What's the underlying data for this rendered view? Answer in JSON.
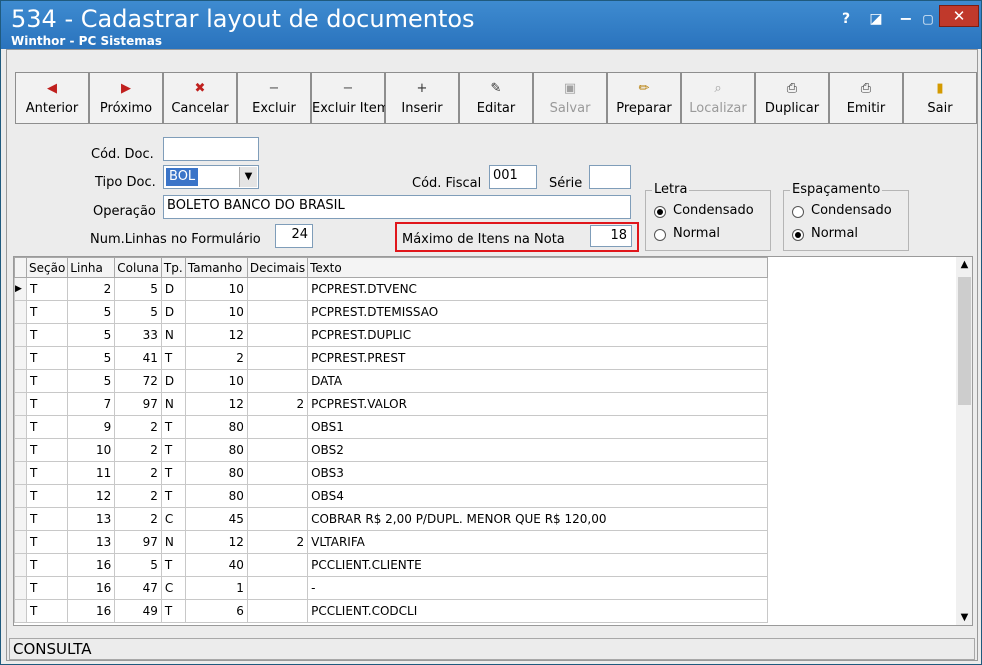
{
  "window": {
    "title": "534 - Cadastrar layout de documentos",
    "subtitle": "Winthor - PC Sistemas",
    "help": "?",
    "close": "✕"
  },
  "toolbar": [
    {
      "label": "Anterior",
      "icon": "arrow-left-icon",
      "glyph": "◀",
      "color": "#c0201e",
      "enabled": true
    },
    {
      "label": "Próximo",
      "icon": "arrow-right-icon",
      "glyph": "▶",
      "color": "#c0201e",
      "enabled": true
    },
    {
      "label": "Cancelar",
      "icon": "cancel-icon",
      "glyph": "✖",
      "color": "#c0201e",
      "enabled": true
    },
    {
      "label": "Excluir",
      "icon": "minus-icon",
      "glyph": "−",
      "color": "#555555",
      "enabled": true
    },
    {
      "label": "Excluir Item",
      "icon": "minus-icon",
      "glyph": "−",
      "color": "#555555",
      "enabled": true
    },
    {
      "label": "Inserir",
      "icon": "plus-icon",
      "glyph": "+",
      "color": "#333333",
      "enabled": true
    },
    {
      "label": "Editar",
      "icon": "edit-icon",
      "glyph": "✎",
      "color": "#333333",
      "enabled": true
    },
    {
      "label": "Salvar",
      "icon": "save-icon",
      "glyph": "▣",
      "color": "#9a9a9a",
      "enabled": false
    },
    {
      "label": "Preparar",
      "icon": "pencil-icon",
      "glyph": "✏",
      "color": "#b57b00",
      "enabled": true
    },
    {
      "label": "Localizar",
      "icon": "search-icon",
      "glyph": "⌕",
      "color": "#9a9a9a",
      "enabled": false
    },
    {
      "label": "Duplicar",
      "icon": "printer-icon",
      "glyph": "⎙",
      "color": "#333333",
      "enabled": true
    },
    {
      "label": "Emitir",
      "icon": "print-icon",
      "glyph": "⎙",
      "color": "#333333",
      "enabled": true
    },
    {
      "label": "Sair",
      "icon": "exit-door-icon",
      "glyph": "▮",
      "color": "#d49a00",
      "enabled": true
    }
  ],
  "form": {
    "cod_doc_label": "Cód. Doc.",
    "cod_doc_value": "",
    "tipo_doc_label": "Tipo Doc.",
    "tipo_doc_value": "BOL",
    "cod_fiscal_label": "Cód. Fiscal",
    "cod_fiscal_value": "001",
    "serie_label": "Série",
    "serie_value": "",
    "operacao_label": "Operação",
    "operacao_value": "BOLETO BANCO DO BRASIL",
    "num_linhas_label": "Num.Linhas no Formulário",
    "num_linhas_value": "24",
    "max_itens_label": "Máximo de Itens na Nota",
    "max_itens_value": "18"
  },
  "letra": {
    "title": "Letra",
    "options": [
      "Condensado",
      "Normal"
    ],
    "selected": 0
  },
  "espacamento": {
    "title": "Espaçamento",
    "options": [
      "Condensado",
      "Normal"
    ],
    "selected": 1
  },
  "grid": {
    "columns": [
      "Seção",
      "Linha",
      "Coluna",
      "Tp.",
      "Tamanho",
      "Decimais",
      "Texto"
    ],
    "rows": [
      [
        "T",
        "2",
        "5",
        "D",
        "10",
        "",
        "PCPREST.DTVENC"
      ],
      [
        "T",
        "5",
        "5",
        "D",
        "10",
        "",
        "PCPREST.DTEMISSAO"
      ],
      [
        "T",
        "5",
        "33",
        "N",
        "12",
        "",
        "PCPREST.DUPLIC"
      ],
      [
        "T",
        "5",
        "41",
        "T",
        "2",
        "",
        "PCPREST.PREST"
      ],
      [
        "T",
        "5",
        "72",
        "D",
        "10",
        "",
        "DATA"
      ],
      [
        "T",
        "7",
        "97",
        "N",
        "12",
        "2",
        "PCPREST.VALOR"
      ],
      [
        "T",
        "9",
        "2",
        "T",
        "80",
        "",
        "OBS1"
      ],
      [
        "T",
        "10",
        "2",
        "T",
        "80",
        "",
        "OBS2"
      ],
      [
        "T",
        "11",
        "2",
        "T",
        "80",
        "",
        "OBS3"
      ],
      [
        "T",
        "12",
        "2",
        "T",
        "80",
        "",
        "OBS4"
      ],
      [
        "T",
        "13",
        "2",
        "C",
        "45",
        "",
        "COBRAR R$ 2,00 P/DUPL. MENOR QUE R$ 120,00"
      ],
      [
        "T",
        "13",
        "97",
        "N",
        "12",
        "2",
        "VLTARIFA"
      ],
      [
        "T",
        "16",
        "5",
        "T",
        "40",
        "",
        "PCCLIENT.CLIENTE"
      ],
      [
        "T",
        "16",
        "47",
        "C",
        "1",
        "",
        "-"
      ],
      [
        "T",
        "16",
        "49",
        "T",
        "6",
        "",
        "PCCLIENT.CODCLI"
      ]
    ]
  },
  "status": "CONSULTA",
  "colors": {
    "title_bar": "#2f7cc4",
    "highlight": "#e0161b",
    "selection": "#3a74c8"
  }
}
